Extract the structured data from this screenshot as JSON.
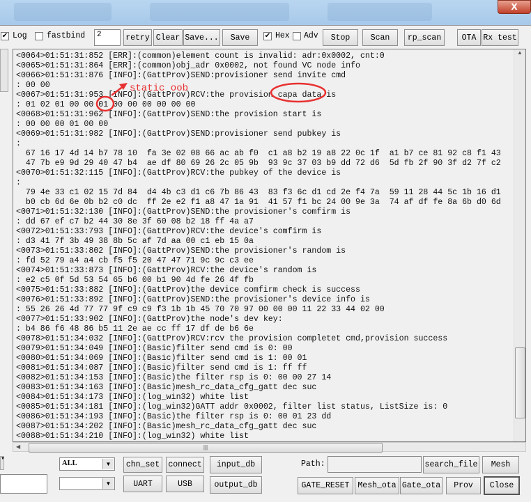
{
  "window": {
    "close_glyph": "X"
  },
  "toolbar": {
    "log_label": "Log",
    "log_checked": true,
    "fastbind_label": "fastbind",
    "fastbind_checked": false,
    "retry_count": "2",
    "retry": "retry",
    "clear": "Clear",
    "save_as": "Save...",
    "save": "Save",
    "hex_label": "Hex",
    "hex_checked": true,
    "adv_label": "Adv",
    "adv_checked": false,
    "stop": "Stop",
    "scan": "Scan",
    "rp_scan": "rp_scan",
    "ota": "OTA",
    "rx_test": "Rx test"
  },
  "log_lines": [
    "<0064>01:51:31:852 [ERR]:(common)element count is invalid: adr:0x0002, cnt:0",
    "<0065>01:51:31:864 [ERR]:(common)obj_adr 0x0002, not found VC node info",
    "<0066>01:51:31:876 [INFO]:(GattProv)SEND:provisioner send invite cmd",
    ": 00 00",
    "<0067>01:51:31:953 [INFO]:(GattProv)RCV:the provision capa data is",
    ": 01 02 01 00 00 01 00 00 00 00 00 00",
    "<0068>01:51:31:962 [INFO]:(GattProv)SEND:the provision start is",
    ": 00 00 00 01 00 00",
    "<0069>01:51:31:982 [INFO]:(GattProv)SEND:provisioner send pubkey is",
    ":",
    "  67 16 17 4d 14 b7 78 10  fa 3e 02 08 66 ac ab f0  c1 a8 b2 19 a8 22 0c 1f  a1 b7 ce 81 92 c8 f1 43",
    "  47 7b e9 9d 29 40 47 b4  ae df 80 69 26 2c 05 9b  93 9c 37 03 b9 dd 72 d6  5d fb 2f 90 3f d2 7f c2",
    "<0070>01:51:32:115 [INFO]:(GattProv)RCV:the pubkey of the device is",
    ":",
    "  79 4e 33 c1 02 15 7d 84  d4 4b c3 d1 c6 7b 86 43  83 f3 6c d1 cd 2e f4 7a  59 11 28 44 5c 1b 16 d1",
    "  b0 cb 6d 6e 0b b2 c0 dc  ff 2e e2 f1 a8 47 1a 91  41 57 f1 bc 24 00 9e 3a  74 af df fe 8a 6b d0 6d",
    "<0071>01:51:32:130 [INFO]:(GattProv)SEND:the provisioner's comfirm is",
    ": dd 67 ef c7 b2 44 30 8e 3f 60 08 b2 18 ff 4a a7",
    "<0072>01:51:33:793 [INFO]:(GattProv)RCV:the device's comfirm is",
    ": d3 41 7f 3b 49 38 8b 5c af 7d aa 00 c1 eb 15 0a",
    "<0073>01:51:33:802 [INFO]:(GattProv)SEND:the provisioner's random is",
    ": fd 52 79 a4 a4 cb f5 f5 20 47 47 71 9c 9c c3 ee",
    "<0074>01:51:33:873 [INFO]:(GattProv)RCV:the device's random is",
    ": e2 c5 0f 5d 53 54 65 b6 00 b1 90 4d fe 26 4f fb",
    "<0075>01:51:33:882 [INFO]:(GattProv)the device comfirm check is success",
    "<0076>01:51:33:892 [INFO]:(GattProv)SEND:the provisioner's device info is",
    ": 55 26 26 4d 77 77 9f c9 c9 f3 1b 1b 45 70 70 97 00 00 00 11 22 33 44 02 00",
    "<0077>01:51:33:902 [INFO]:(GattProv)the node's dev key:",
    ": b4 86 f6 48 86 b5 11 2e ae cc ff 17 df de b6 6e",
    "<0078>01:51:34:032 [INFO]:(GattProv)RCV:rcv the provision completet cmd,provision success",
    "<0079>01:51:34:049 [INFO]:(Basic)filter send cmd is 0: 00",
    "<0080>01:51:34:069 [INFO]:(Basic)filter send cmd is 1: 00 01",
    "<0081>01:51:34:087 [INFO]:(Basic)filter send cmd is 1: ff ff",
    "<0082>01:51:34:153 [INFO]:(Basic)the filter rsp is 0: 00 00 27 14",
    "<0083>01:51:34:163 [INFO]:(Basic)mesh_rc_data_cfg_gatt dec suc",
    "<0084>01:51:34:173 [INFO]:(log_win32) white list",
    "<0085>01:51:34:181 [INFO]:(log_win32)GATT addr 0x0002, filter list status, ListSize is: 0",
    "<0086>01:51:34:193 [INFO]:(Basic)the filter rsp is 0: 00 01 23 dd",
    "<0087>01:51:34:202 [INFO]:(Basic)mesh_rc_data_cfg_gatt dec suc",
    "<0088>01:51:34:210 [INFO]:(log_win32) white list"
  ],
  "annotation": {
    "text": "static oob",
    "color": "#e83030"
  },
  "bottom": {
    "channel_select": "ALL",
    "second_select": "",
    "chn_set": "chn_set",
    "connect": "connect",
    "input_db": "input_db",
    "uart": "UART",
    "usb": "USB",
    "output_db": "output_db",
    "path_label": "Path:",
    "path_value": "",
    "search_file": "search_file",
    "mesh": "Mesh",
    "gate_reset": "GATE_RESET",
    "mesh_ota": "Mesh_ota",
    "gate_ota": "Gate_ota",
    "prov": "Prov",
    "close": "Close"
  }
}
